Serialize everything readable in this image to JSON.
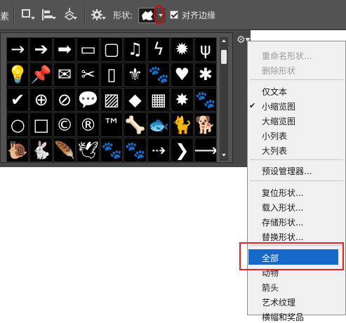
{
  "toolbar": {
    "left_text": "素",
    "shape_label": "形状:",
    "align_edges_label": "对齐边缘",
    "align_edges_checked": true
  },
  "shape_panel": {
    "rows": [
      [
        "→",
        "➔",
        "➡",
        "▭",
        "▢",
        "♫",
        "ϟ",
        "✹",
        "ψ"
      ],
      [
        "💡",
        "📌",
        "✉",
        "✂",
        "▯",
        "⚜",
        "🐾",
        "♥",
        "✱"
      ],
      [
        "✔",
        "⊕",
        "⊘",
        "💬",
        "▨",
        "◆",
        "▦",
        "✸",
        "🐾"
      ],
      [
        "○",
        "□",
        "©",
        "®",
        "™",
        "🦴",
        "🐟",
        "🐈",
        "🐕"
      ],
      [
        "🐌",
        "🐇",
        "🪶",
        "🕊",
        "🐾",
        "🐾",
        "⇢",
        "❯",
        "⟶"
      ]
    ]
  },
  "menu": {
    "items": [
      {
        "label": "重命名形状...",
        "disabled": true,
        "checked": false
      },
      {
        "label": "删除形状",
        "disabled": true,
        "checked": false
      },
      {
        "label": "仅文本",
        "disabled": false,
        "checked": false
      },
      {
        "label": "小缩览图",
        "disabled": false,
        "checked": true
      },
      {
        "label": "大缩览图",
        "disabled": false,
        "checked": false
      },
      {
        "label": "小列表",
        "disabled": false,
        "checked": false
      },
      {
        "label": "大列表",
        "disabled": false,
        "checked": false
      },
      {
        "label": "预设管理器...",
        "disabled": false,
        "checked": false
      },
      {
        "label": "复位形状...",
        "disabled": false,
        "checked": false
      },
      {
        "label": "载入形状...",
        "disabled": false,
        "checked": false
      },
      {
        "label": "存储形状...",
        "disabled": false,
        "checked": false
      },
      {
        "label": "替换形状...",
        "disabled": false,
        "checked": false
      },
      {
        "label": "全部",
        "disabled": false,
        "checked": false,
        "highlighted": true
      },
      {
        "label": "动物",
        "disabled": false,
        "checked": false
      },
      {
        "label": "箭头",
        "disabled": false,
        "checked": false
      },
      {
        "label": "艺术纹理",
        "disabled": false,
        "checked": false
      },
      {
        "label": "横幅和奖品",
        "disabled": false,
        "checked": false
      }
    ]
  },
  "colors": {
    "toolbar_bg": "#535353",
    "highlight": "#1668c9",
    "annotation_red": "#e60000"
  }
}
